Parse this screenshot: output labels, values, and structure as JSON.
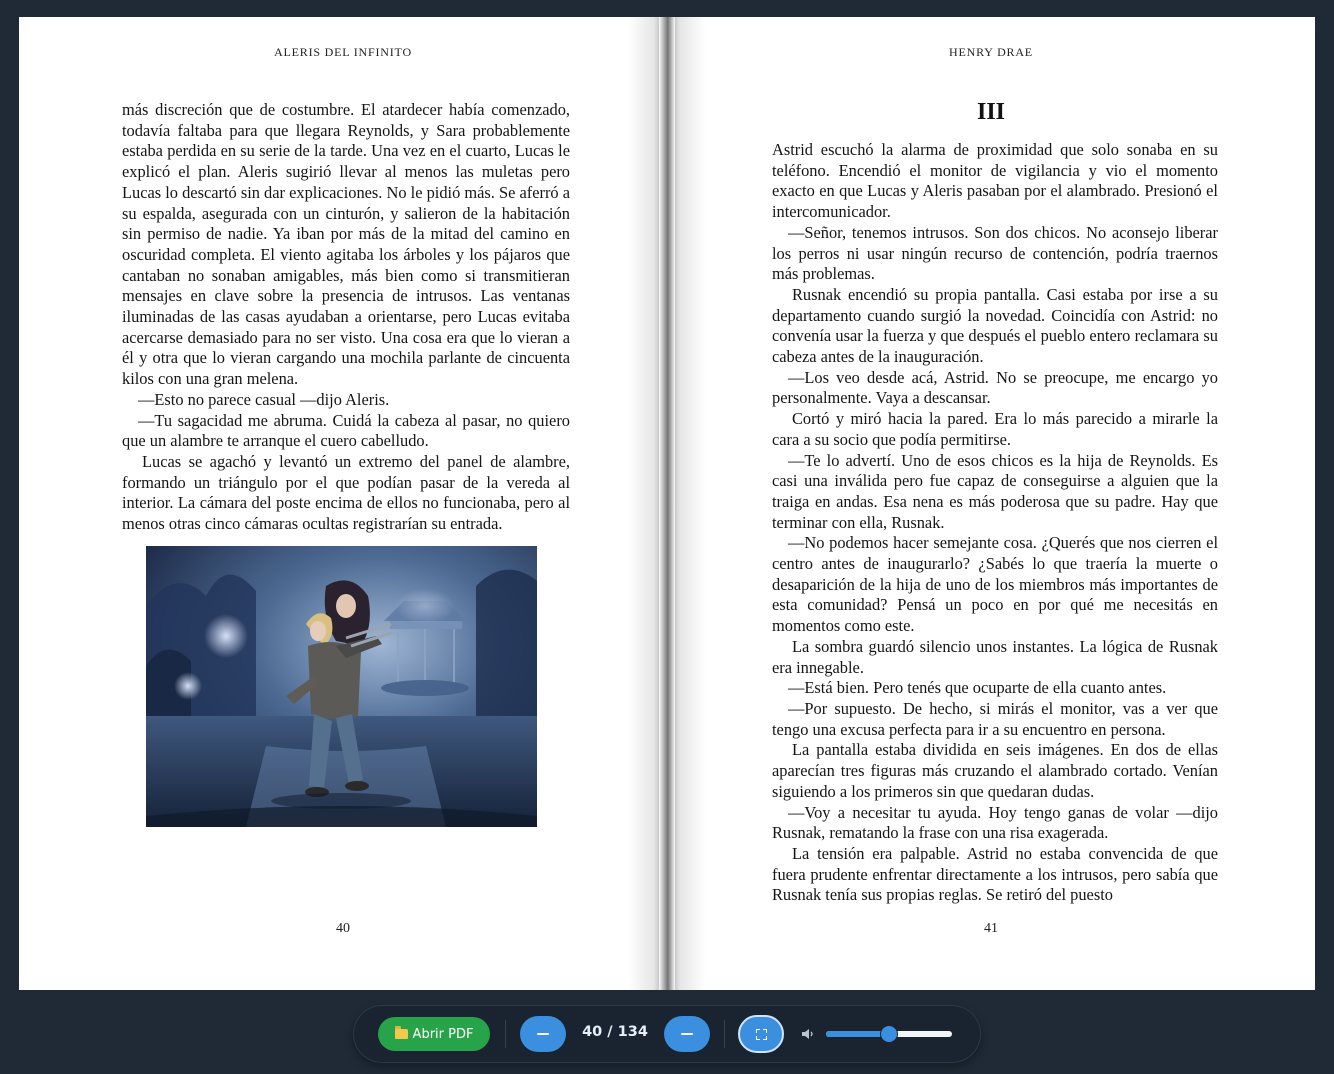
{
  "book": {
    "left_page": {
      "running_head": "ALERIS DEL INFINITO",
      "page_number": "40",
      "paragraphs": [
        {
          "style": "plain",
          "text": "más discreción que de costumbre. El atardecer había comenzado, todavía faltaba para que llegara Reynolds, y Sara probablemente estaba perdida en su serie de la tarde. Una vez en el cuarto, Lucas le explicó el plan. Aleris sugirió llevar al menos las muletas pero Lucas lo descartó sin dar explicaciones. No le pidió más. Se aferró a su espalda, asegurada con un cinturón, y salieron de la habitación sin permiso de nadie. Ya iban por más de la mitad del camino en oscuridad completa. El viento agitaba los árboles y los pájaros que cantaban no sonaban amigables, más bien como si transmitieran mensajes en clave sobre la presencia de intrusos. Las ventanas iluminadas de las casas ayudaban a orientarse, pero Lucas evitaba acercarse demasiado para no ser visto. Una cosa era que lo vieran a él y otra que lo vieran cargando una mochila parlante de cincuenta kilos con una gran melena."
        },
        {
          "style": "dialog",
          "text": "—Esto no parece casual —dijo Aleris."
        },
        {
          "style": "dialog",
          "text": "—Tu sagacidad me abruma. Cuidá la cabeza al pasar, no quiero que un alambre te arranque el cuero cabelludo."
        },
        {
          "style": "indent",
          "text": "Lucas se agachó y levantó un extremo del panel de alambre, formando un triángulo por el que podían pasar de la vereda al interior. La cámara del poste encima de ellos no funcionaba, pero al menos otras cinco cámaras ocultas registrarían su entrada."
        }
      ]
    },
    "right_page": {
      "running_head": "HENRY DRAE",
      "chapter_heading": "III",
      "page_number": "41",
      "paragraphs": [
        {
          "style": "plain",
          "text": "Astrid escuchó la alarma de proximidad que solo sonaba en su teléfono. Encendió el monitor de vigilancia y vio el momento exacto en que Lucas y Aleris pasaban por el alambrado. Presionó el intercomunicador."
        },
        {
          "style": "dialog",
          "text": "—Señor, tenemos intrusos. Son dos chicos. No aconsejo liberar los perros ni usar ningún recurso de contención, podría traernos más problemas."
        },
        {
          "style": "indent",
          "text": "Rusnak encendió su propia pantalla. Casi estaba por irse a su departamento cuando surgió la novedad. Coincidía con Astrid: no convenía usar la fuerza y que después el pueblo entero reclamara su cabeza antes de la inauguración."
        },
        {
          "style": "dialog",
          "text": "—Los veo desde acá, Astrid. No se preocupe, me encargo yo personalmente. Vaya a descansar."
        },
        {
          "style": "indent",
          "text": "Cortó y miró hacia la pared. Era lo más parecido a mirarle la cara a su socio que podía permitirse."
        },
        {
          "style": "dialog",
          "text": "—Te lo advertí. Uno de esos chicos es la hija de Reynolds. Es casi una inválida pero fue capaz de conseguirse a alguien que la traiga en andas. Esa nena es más poderosa que su padre. Hay que terminar con ella, Rusnak."
        },
        {
          "style": "dialog",
          "text": "—No podemos hacer semejante cosa. ¿Querés que nos cierren el centro antes de inaugurarlo? ¿Sabés lo que traería la muerte o desaparición de la hija de uno de los miembros más importantes de esta comunidad? Pensá un poco en por qué me necesitás en momentos como este."
        },
        {
          "style": "indent",
          "text": "La sombra guardó silencio unos instantes. La lógica de Rusnak era innegable."
        },
        {
          "style": "dialog",
          "text": "—Está bien. Pero tenés que ocuparte de ella cuanto antes."
        },
        {
          "style": "dialog",
          "text": "—Por supuesto. De hecho, si mirás el monitor, vas a ver que tengo una excusa perfecta para ir a su encuentro en persona."
        },
        {
          "style": "indent",
          "text": "La pantalla estaba dividida en seis imágenes. En dos de ellas aparecían tres figuras más cruzando el alambrado cortado. Venían siguiendo a los primeros sin que quedaran dudas."
        },
        {
          "style": "dialog",
          "text": "—Voy a necesitar tu ayuda. Hoy tengo ganas de volar —dijo Rusnak, rematando la frase con una risa exagerada."
        },
        {
          "style": "indent",
          "text": "La tensión era palpable. Astrid no estaba convencida de que fuera prudente enfrentar directamente a los intrusos, pero sabía que Rusnak tenía sus propias reglas. Se retiró del puesto"
        }
      ]
    }
  },
  "toolbar": {
    "open_pdf_label": "Abrir PDF",
    "open_pdf_icon": "folder-icon",
    "prev_page_icon": "minus-icon",
    "next_page_icon": "minus-icon",
    "page_indicator": "40 / 134",
    "fullscreen_icon": "fullscreen-icon",
    "volume_icon": "speaker-icon",
    "volume_level": 0.5,
    "colors": {
      "open_pdf": "#27a34a",
      "accent": "#3a8fde",
      "toolbar_bg": "#1a2430",
      "window_bg": "#1f2a36"
    }
  }
}
